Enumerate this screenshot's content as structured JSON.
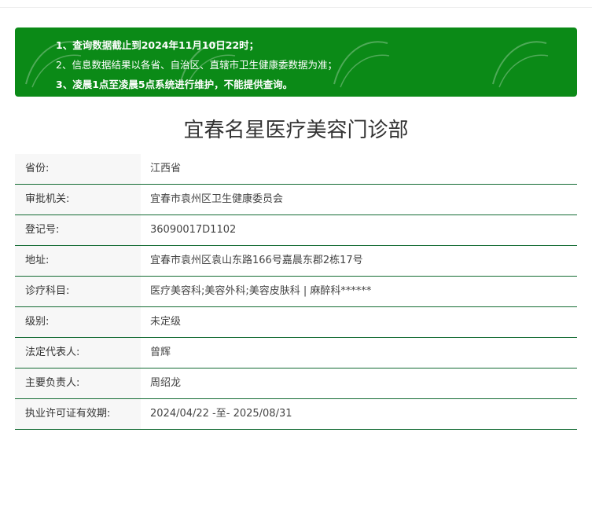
{
  "notice": {
    "line1": "1、查询数据截止到2024年11月10日22时；",
    "line2": "2、信息数据结果以各省、自治区、直辖市卫生健康委数据为准；",
    "line3": "3、凌晨1点至凌晨5点系统进行维护，不能提供查询。",
    "background_color": "#0b8a17"
  },
  "page_title": "宜春名星医疗美容门诊部",
  "rows": [
    {
      "label": "省份:",
      "value": "江西省"
    },
    {
      "label": "审批机关:",
      "value": "宜春市袁州区卫生健康委员会"
    },
    {
      "label": "登记号:",
      "value": "36090017D1102"
    },
    {
      "label": "地址:",
      "value": "宜春市袁州区袁山东路166号嘉晨东郡2栋17号"
    },
    {
      "label": "诊疗科目:",
      "value": "医疗美容科;美容外科;美容皮肤科 | 麻醉科******"
    },
    {
      "label": "级别:",
      "value": "未定级"
    },
    {
      "label": "法定代表人:",
      "value": "曾辉"
    },
    {
      "label": "主要负责人:",
      "value": "周绍龙"
    },
    {
      "label": "执业许可证有效期:",
      "value": "2024/04/22 -至- 2025/08/31"
    }
  ],
  "row_border_color": "#136b33"
}
